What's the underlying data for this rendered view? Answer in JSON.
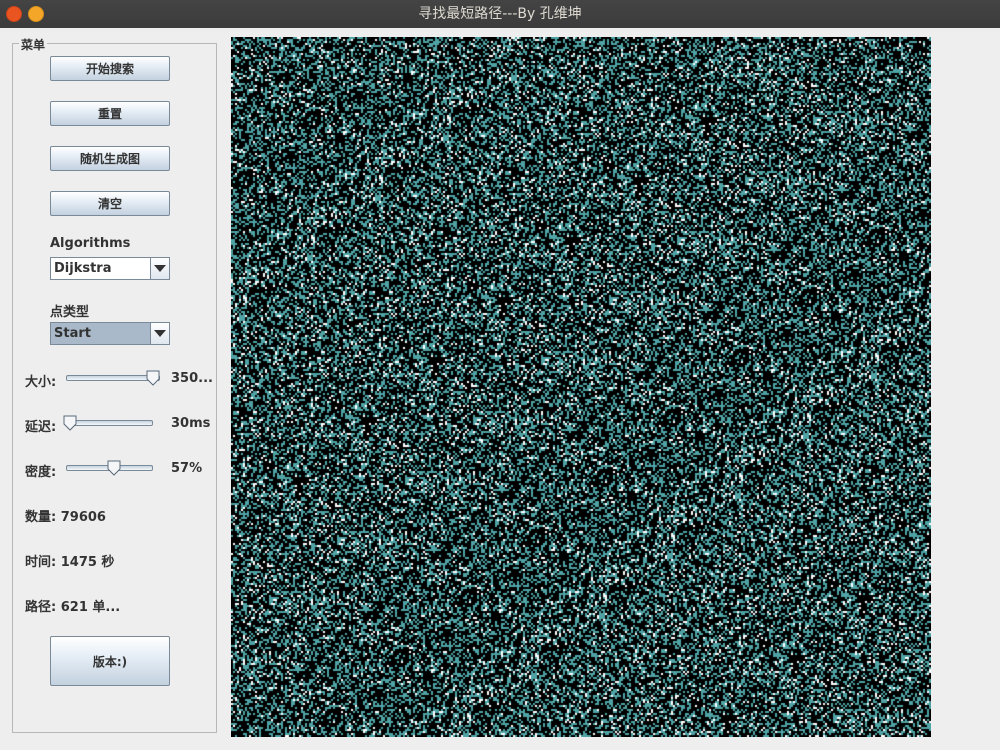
{
  "window": {
    "title": "寻找最短路径---By 孔维坤"
  },
  "menu": {
    "title": "菜单",
    "buttons": {
      "start_search": "开始搜索",
      "reset": "重置",
      "random_generate": "随机生成图",
      "clear": "清空",
      "version": "版本:)"
    },
    "algorithms": {
      "label": "Algorithms",
      "selected": "Dijkstra"
    },
    "point_type": {
      "label": "点类型",
      "selected": "Start"
    },
    "sliders": {
      "size": {
        "label": "大小:",
        "value_text": "350...",
        "level": 0.95
      },
      "delay": {
        "label": "延迟:",
        "value_text": "30ms",
        "level": 0.05
      },
      "density": {
        "label": "密度:",
        "value_text": "57%",
        "level": 0.57
      }
    },
    "stats": {
      "count": "数量: 79606",
      "time": "时间: 1475 秒",
      "path": "路径: 621 单..."
    }
  },
  "grid": {
    "cells_per_side": 350,
    "density": 0.57,
    "colors": {
      "background": "#000000",
      "wall": "#4fa3a5",
      "visited": "#ffffff"
    }
  },
  "colors": {
    "accent_close": "#e95420",
    "accent_minimize": "#f4a628",
    "panel_background": "#eeeeee"
  }
}
